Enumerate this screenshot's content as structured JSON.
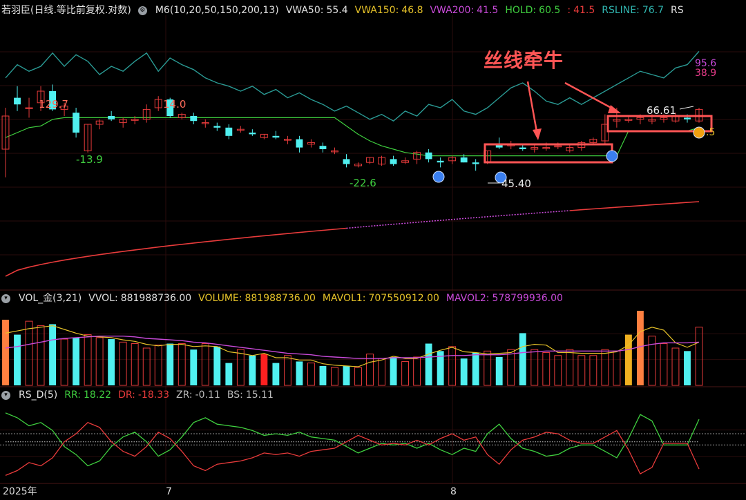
{
  "main_header": {
    "title": "若羽臣(日线.等比前复权.对数)",
    "indicator_name": "M6(10,20,50,150,200,13)",
    "fields": [
      {
        "label": "VWA50:",
        "value": "55.4",
        "color": "#e0e0e0"
      },
      {
        "label": "VWA150:",
        "value": "46.8",
        "color": "#e6c229"
      },
      {
        "label": "VWA200:",
        "value": "41.5",
        "color": "#c84ad8"
      },
      {
        "label": "HOLD:",
        "value": "60.5",
        "color": "#3fcf3f"
      },
      {
        "label": ":",
        "value": "41.5",
        "color": "#e83b3b"
      },
      {
        "label": "RSLINE:",
        "value": "76.7",
        "color": "#30b6b0"
      },
      {
        "label": "RS",
        "value": "",
        "color": "#e0e0e0"
      }
    ]
  },
  "vol_header": {
    "title": "VOL_金(3,21)",
    "fields": [
      {
        "label": "VVOL:",
        "value": "881988736.00",
        "color": "#e0e0e0"
      },
      {
        "label": "VOLUME:",
        "value": "881988736.00",
        "color": "#e6c229"
      },
      {
        "label": "MAVOL1:",
        "value": "707550912.00",
        "color": "#e6c229"
      },
      {
        "label": "MAVOL2:",
        "value": "578799936.00",
        "color": "#c84ad8"
      }
    ]
  },
  "rs_header": {
    "title": "RS_D(5)",
    "fields": [
      {
        "label": "RR:",
        "value": "18.22",
        "color": "#3fcf3f"
      },
      {
        "label": "DR:",
        "value": "-18.33",
        "color": "#e83b3b"
      },
      {
        "label": "ZR:",
        "value": "-0.11",
        "color": "#bbbbbb"
      },
      {
        "label": "BS:",
        "value": "15.11",
        "color": "#bbbbbb"
      }
    ]
  },
  "date_labels": [
    "2025年",
    "7",
    "8"
  ],
  "annotation_text": "丝线牵牛",
  "price_labels": {
    "high1": "129.7",
    "high2": "14.0",
    "low1": "-13.9",
    "low2": "-22.6",
    "low3": "45.40",
    "last_high": "66.61",
    "right_top": "95.6",
    "right_mid": "38.9",
    "right_small": ".5"
  },
  "colors": {
    "up": "#e83b3b",
    "down": "#50f0f0",
    "rsline": "#2a9a94",
    "hold": "#3fcf3f",
    "vwa200": "#c84ad8",
    "mavol1": "#e6c229",
    "annotation": "#ff5555"
  },
  "chart_data": {
    "type": "candlestick",
    "candles": [
      {
        "o": 0.35,
        "h": 0.6,
        "l": 0.18,
        "c": 0.55
      },
      {
        "o": 0.66,
        "h": 0.73,
        "l": 0.58,
        "c": 0.62
      },
      {
        "o": 0.6,
        "h": 0.66,
        "l": 0.54,
        "c": 0.6
      },
      {
        "o": 0.63,
        "h": 0.73,
        "l": 0.58,
        "c": 0.7
      },
      {
        "o": 0.7,
        "h": 0.74,
        "l": 0.58,
        "c": 0.59
      },
      {
        "o": 0.59,
        "h": 0.63,
        "l": 0.55,
        "c": 0.61
      },
      {
        "o": 0.57,
        "h": 0.6,
        "l": 0.42,
        "c": 0.45
      },
      {
        "o": 0.34,
        "h": 0.5,
        "l": 0.33,
        "c": 0.5
      },
      {
        "o": 0.5,
        "h": 0.53,
        "l": 0.47,
        "c": 0.52
      },
      {
        "o": 0.55,
        "h": 0.58,
        "l": 0.52,
        "c": 0.53
      },
      {
        "o": 0.51,
        "h": 0.54,
        "l": 0.48,
        "c": 0.53
      },
      {
        "o": 0.53,
        "h": 0.55,
        "l": 0.5,
        "c": 0.53
      },
      {
        "o": 0.53,
        "h": 0.62,
        "l": 0.51,
        "c": 0.59
      },
      {
        "o": 0.6,
        "h": 0.67,
        "l": 0.58,
        "c": 0.65
      },
      {
        "o": 0.65,
        "h": 0.66,
        "l": 0.54,
        "c": 0.55
      },
      {
        "o": 0.54,
        "h": 0.57,
        "l": 0.53,
        "c": 0.56
      },
      {
        "o": 0.55,
        "h": 0.57,
        "l": 0.5,
        "c": 0.52
      },
      {
        "o": 0.51,
        "h": 0.53,
        "l": 0.48,
        "c": 0.51
      },
      {
        "o": 0.49,
        "h": 0.51,
        "l": 0.46,
        "c": 0.48
      },
      {
        "o": 0.48,
        "h": 0.5,
        "l": 0.41,
        "c": 0.43
      },
      {
        "o": 0.47,
        "h": 0.49,
        "l": 0.45,
        "c": 0.47
      },
      {
        "o": 0.45,
        "h": 0.47,
        "l": 0.43,
        "c": 0.44
      },
      {
        "o": 0.42,
        "h": 0.44,
        "l": 0.41,
        "c": 0.44
      },
      {
        "o": 0.43,
        "h": 0.46,
        "l": 0.41,
        "c": 0.42
      },
      {
        "o": 0.41,
        "h": 0.43,
        "l": 0.38,
        "c": 0.41
      },
      {
        "o": 0.41,
        "h": 0.43,
        "l": 0.33,
        "c": 0.36
      },
      {
        "o": 0.38,
        "h": 0.41,
        "l": 0.36,
        "c": 0.39
      },
      {
        "o": 0.37,
        "h": 0.39,
        "l": 0.33,
        "c": 0.35
      },
      {
        "o": 0.34,
        "h": 0.36,
        "l": 0.32,
        "c": 0.34
      },
      {
        "o": 0.29,
        "h": 0.32,
        "l": 0.24,
        "c": 0.26
      },
      {
        "o": 0.25,
        "h": 0.27,
        "l": 0.24,
        "c": 0.26
      },
      {
        "o": 0.27,
        "h": 0.3,
        "l": 0.26,
        "c": 0.3
      },
      {
        "o": 0.26,
        "h": 0.31,
        "l": 0.25,
        "c": 0.3
      },
      {
        "o": 0.29,
        "h": 0.31,
        "l": 0.25,
        "c": 0.26
      },
      {
        "o": 0.27,
        "h": 0.3,
        "l": 0.26,
        "c": 0.28
      },
      {
        "o": 0.29,
        "h": 0.34,
        "l": 0.26,
        "c": 0.33
      },
      {
        "o": 0.33,
        "h": 0.35,
        "l": 0.27,
        "c": 0.29
      },
      {
        "o": 0.28,
        "h": 0.3,
        "l": 0.24,
        "c": 0.27
      },
      {
        "o": 0.28,
        "h": 0.31,
        "l": 0.26,
        "c": 0.3
      },
      {
        "o": 0.3,
        "h": 0.32,
        "l": 0.27,
        "c": 0.27
      },
      {
        "o": 0.27,
        "h": 0.29,
        "l": 0.22,
        "c": 0.26
      },
      {
        "o": 0.27,
        "h": 0.34,
        "l": 0.26,
        "c": 0.34
      },
      {
        "o": 0.38,
        "h": 0.42,
        "l": 0.35,
        "c": 0.36
      },
      {
        "o": 0.37,
        "h": 0.4,
        "l": 0.35,
        "c": 0.38
      },
      {
        "o": 0.36,
        "h": 0.38,
        "l": 0.34,
        "c": 0.35
      },
      {
        "o": 0.35,
        "h": 0.38,
        "l": 0.33,
        "c": 0.36
      },
      {
        "o": 0.36,
        "h": 0.39,
        "l": 0.34,
        "c": 0.36
      },
      {
        "o": 0.37,
        "h": 0.39,
        "l": 0.35,
        "c": 0.37
      },
      {
        "o": 0.34,
        "h": 0.38,
        "l": 0.33,
        "c": 0.36
      },
      {
        "o": 0.36,
        "h": 0.4,
        "l": 0.34,
        "c": 0.39
      },
      {
        "o": 0.39,
        "h": 0.42,
        "l": 0.38,
        "c": 0.41
      },
      {
        "o": 0.4,
        "h": 0.56,
        "l": 0.38,
        "c": 0.5
      },
      {
        "o": 0.52,
        "h": 0.6,
        "l": 0.48,
        "c": 0.53
      },
      {
        "o": 0.53,
        "h": 0.55,
        "l": 0.51,
        "c": 0.53
      },
      {
        "o": 0.53,
        "h": 0.56,
        "l": 0.5,
        "c": 0.54
      },
      {
        "o": 0.52,
        "h": 0.56,
        "l": 0.5,
        "c": 0.53
      },
      {
        "o": 0.53,
        "h": 0.56,
        "l": 0.51,
        "c": 0.54
      },
      {
        "o": 0.52,
        "h": 0.57,
        "l": 0.51,
        "c": 0.55
      },
      {
        "o": 0.54,
        "h": 0.56,
        "l": 0.51,
        "c": 0.53
      },
      {
        "o": 0.52,
        "h": 0.6,
        "l": 0.51,
        "c": 0.59
      }
    ],
    "rsline": [
      0.78,
      0.86,
      0.82,
      0.85,
      0.93,
      0.85,
      0.92,
      0.88,
      0.8,
      0.85,
      0.82,
      0.88,
      0.93,
      0.82,
      0.9,
      0.86,
      0.83,
      0.78,
      0.75,
      0.73,
      0.7,
      0.73,
      0.68,
      0.71,
      0.66,
      0.69,
      0.65,
      0.62,
      0.58,
      0.61,
      0.57,
      0.53,
      0.56,
      0.52,
      0.58,
      0.55,
      0.62,
      0.6,
      0.65,
      0.58,
      0.56,
      0.6,
      0.66,
      0.72,
      0.75,
      0.7,
      0.64,
      0.62,
      0.66,
      0.62,
      0.66,
      0.7,
      0.74,
      0.78,
      0.82,
      0.8,
      0.78,
      0.84,
      0.86,
      0.94
    ],
    "hold": [
      0.42,
      0.45,
      0.48,
      0.49,
      0.53,
      0.54,
      0.54,
      0.54,
      0.54,
      0.54,
      0.54,
      0.54,
      0.54,
      0.54,
      0.54,
      0.54,
      0.54,
      0.54,
      0.54,
      0.54,
      0.54,
      0.54,
      0.54,
      0.54,
      0.54,
      0.54,
      0.54,
      0.54,
      0.54,
      0.49,
      0.44,
      0.4,
      0.37,
      0.35,
      0.33,
      0.32,
      0.31,
      0.31,
      0.31,
      0.31,
      0.31,
      0.31,
      0.31,
      0.31,
      0.31,
      0.31,
      0.31,
      0.31,
      0.31,
      0.31,
      0.31,
      0.31,
      0.31,
      0.46,
      0.46,
      0.46,
      0.46,
      0.46,
      0.46,
      0.48
    ],
    "volume": [
      0.88,
      0.68,
      0.86,
      0.8,
      0.82,
      0.62,
      0.64,
      0.68,
      0.64,
      0.62,
      0.58,
      0.56,
      0.5,
      0.54,
      0.56,
      0.56,
      0.48,
      0.56,
      0.52,
      0.3,
      0.48,
      0.4,
      0.42,
      0.3,
      0.4,
      0.32,
      0.3,
      0.26,
      0.24,
      0.26,
      0.24,
      0.42,
      0.36,
      0.38,
      0.32,
      0.38,
      0.56,
      0.46,
      0.52,
      0.36,
      0.44,
      0.46,
      0.38,
      0.48,
      0.7,
      0.48,
      0.44,
      0.4,
      0.48,
      0.4,
      0.4,
      0.48,
      0.46,
      0.68,
      1.0,
      0.66,
      0.56,
      0.5,
      0.46,
      0.78
    ],
    "mavol1": [
      0.7,
      0.73,
      0.76,
      0.78,
      0.8,
      0.75,
      0.7,
      0.66,
      0.65,
      0.64,
      0.61,
      0.59,
      0.55,
      0.53,
      0.55,
      0.55,
      0.52,
      0.53,
      0.52,
      0.45,
      0.43,
      0.4,
      0.43,
      0.37,
      0.37,
      0.34,
      0.34,
      0.29,
      0.27,
      0.26,
      0.25,
      0.31,
      0.34,
      0.39,
      0.36,
      0.36,
      0.42,
      0.47,
      0.51,
      0.45,
      0.44,
      0.42,
      0.43,
      0.44,
      0.52,
      0.55,
      0.54,
      0.44,
      0.44,
      0.43,
      0.43,
      0.43,
      0.45,
      0.54,
      0.72,
      0.78,
      0.74,
      0.57,
      0.51,
      0.58
    ],
    "mavol2": [
      0.5,
      0.52,
      0.55,
      0.58,
      0.61,
      0.63,
      0.64,
      0.65,
      0.66,
      0.66,
      0.66,
      0.65,
      0.63,
      0.62,
      0.61,
      0.6,
      0.58,
      0.57,
      0.55,
      0.53,
      0.51,
      0.49,
      0.47,
      0.45,
      0.43,
      0.42,
      0.41,
      0.39,
      0.38,
      0.37,
      0.36,
      0.36,
      0.36,
      0.37,
      0.37,
      0.37,
      0.38,
      0.39,
      0.4,
      0.4,
      0.41,
      0.41,
      0.41,
      0.42,
      0.44,
      0.45,
      0.46,
      0.46,
      0.46,
      0.46,
      0.46,
      0.46,
      0.46,
      0.48,
      0.52,
      0.55,
      0.57,
      0.57,
      0.57,
      0.58
    ],
    "rr": [
      0.88,
      0.82,
      0.72,
      0.76,
      0.66,
      0.46,
      0.36,
      0.22,
      0.28,
      0.46,
      0.58,
      0.64,
      0.52,
      0.34,
      0.42,
      0.58,
      0.76,
      0.82,
      0.74,
      0.72,
      0.7,
      0.66,
      0.6,
      0.62,
      0.6,
      0.64,
      0.58,
      0.56,
      0.54,
      0.46,
      0.38,
      0.44,
      0.5,
      0.48,
      0.5,
      0.44,
      0.5,
      0.42,
      0.36,
      0.44,
      0.4,
      0.62,
      0.74,
      0.56,
      0.44,
      0.4,
      0.34,
      0.36,
      0.44,
      0.48,
      0.48,
      0.4,
      0.32,
      0.56,
      0.86,
      0.78,
      0.48,
      0.48,
      0.48,
      0.8
    ],
    "dr": [
      0.1,
      0.16,
      0.26,
      0.22,
      0.32,
      0.52,
      0.62,
      0.76,
      0.7,
      0.52,
      0.4,
      0.34,
      0.46,
      0.64,
      0.56,
      0.4,
      0.22,
      0.16,
      0.24,
      0.26,
      0.28,
      0.32,
      0.38,
      0.36,
      0.38,
      0.34,
      0.4,
      0.42,
      0.44,
      0.52,
      0.6,
      0.54,
      0.48,
      0.5,
      0.48,
      0.54,
      0.48,
      0.56,
      0.62,
      0.54,
      0.58,
      0.36,
      0.24,
      0.42,
      0.54,
      0.58,
      0.64,
      0.62,
      0.54,
      0.5,
      0.5,
      0.58,
      0.66,
      0.42,
      0.12,
      0.2,
      0.5,
      0.5,
      0.5,
      0.18
    ]
  }
}
